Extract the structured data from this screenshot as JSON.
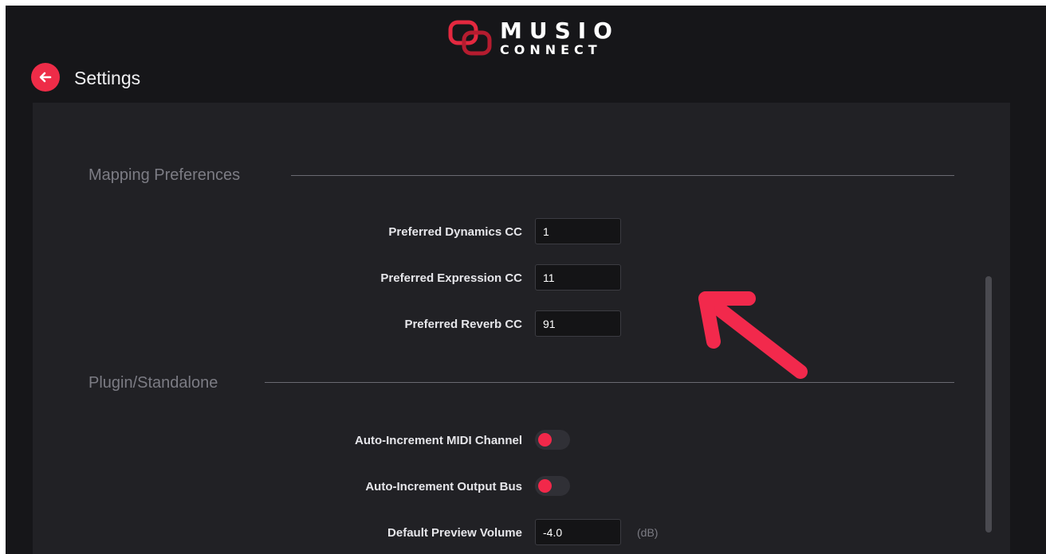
{
  "header": {
    "logo_top": "MUSIO",
    "logo_bottom": "CONNECT",
    "title": "Settings",
    "accent_color": "#ee2c48"
  },
  "sections": {
    "mapping": {
      "title": "Mapping Preferences",
      "rows": [
        {
          "label": "Preferred Dynamics CC",
          "value": "1"
        },
        {
          "label": "Preferred Expression CC",
          "value": "11"
        },
        {
          "label": "Preferred Reverb CC",
          "value": "91"
        }
      ]
    },
    "plugin": {
      "title": "Plugin/Standalone",
      "toggles": [
        {
          "label": "Auto-Increment MIDI Channel",
          "on": false
        },
        {
          "label": "Auto-Increment Output Bus",
          "on": false
        }
      ],
      "volume": {
        "label": "Default Preview Volume",
        "value": "-4.0",
        "unit": "(dB)"
      }
    }
  },
  "icons": {
    "back": "arrow-left-icon",
    "logo": "chain-link-icon",
    "annotation": "pointer-arrow-icon"
  }
}
